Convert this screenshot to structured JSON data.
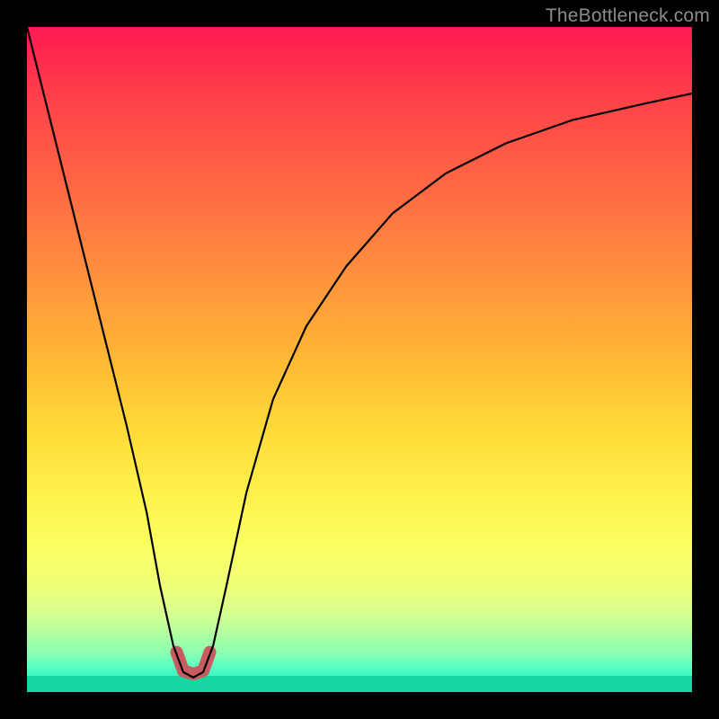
{
  "watermark": "TheBottleneck.com",
  "chart_data": {
    "type": "line",
    "title": "",
    "xlabel": "",
    "ylabel": "",
    "xlim": [
      0,
      100
    ],
    "ylim": [
      0,
      100
    ],
    "gradient_colors_top_to_bottom": [
      "#ff1a52",
      "#ff3f4a",
      "#ff6b44",
      "#ff933d",
      "#ffb834",
      "#ffd938",
      "#fff14a",
      "#fcff62",
      "#f0ff78",
      "#d8ff8e",
      "#b5ffa0",
      "#8bffb0",
      "#5effbf",
      "#31f7c4",
      "#1ee6b4",
      "#14d7a1"
    ],
    "series": [
      {
        "name": "bottleneck-curve",
        "color": "#000000",
        "x": [
          0,
          3,
          6,
          9,
          12,
          15,
          18,
          20,
          22,
          23.5,
          25,
          26.5,
          28,
          30,
          33,
          37,
          42,
          48,
          55,
          63,
          72,
          82,
          93,
          100
        ],
        "y": [
          100,
          88,
          76,
          64,
          52,
          40,
          27,
          16,
          7,
          3,
          2.2,
          3,
          7,
          16,
          30,
          44,
          55,
          64,
          72,
          78,
          82.5,
          86,
          88.5,
          90
        ]
      },
      {
        "name": "optimal-zone-badge",
        "color": "#c85a61",
        "x": [
          22.5,
          23.5,
          25,
          26.5,
          27.5
        ],
        "y": [
          6,
          3.2,
          2.7,
          3.2,
          6
        ]
      }
    ],
    "annotations": []
  }
}
